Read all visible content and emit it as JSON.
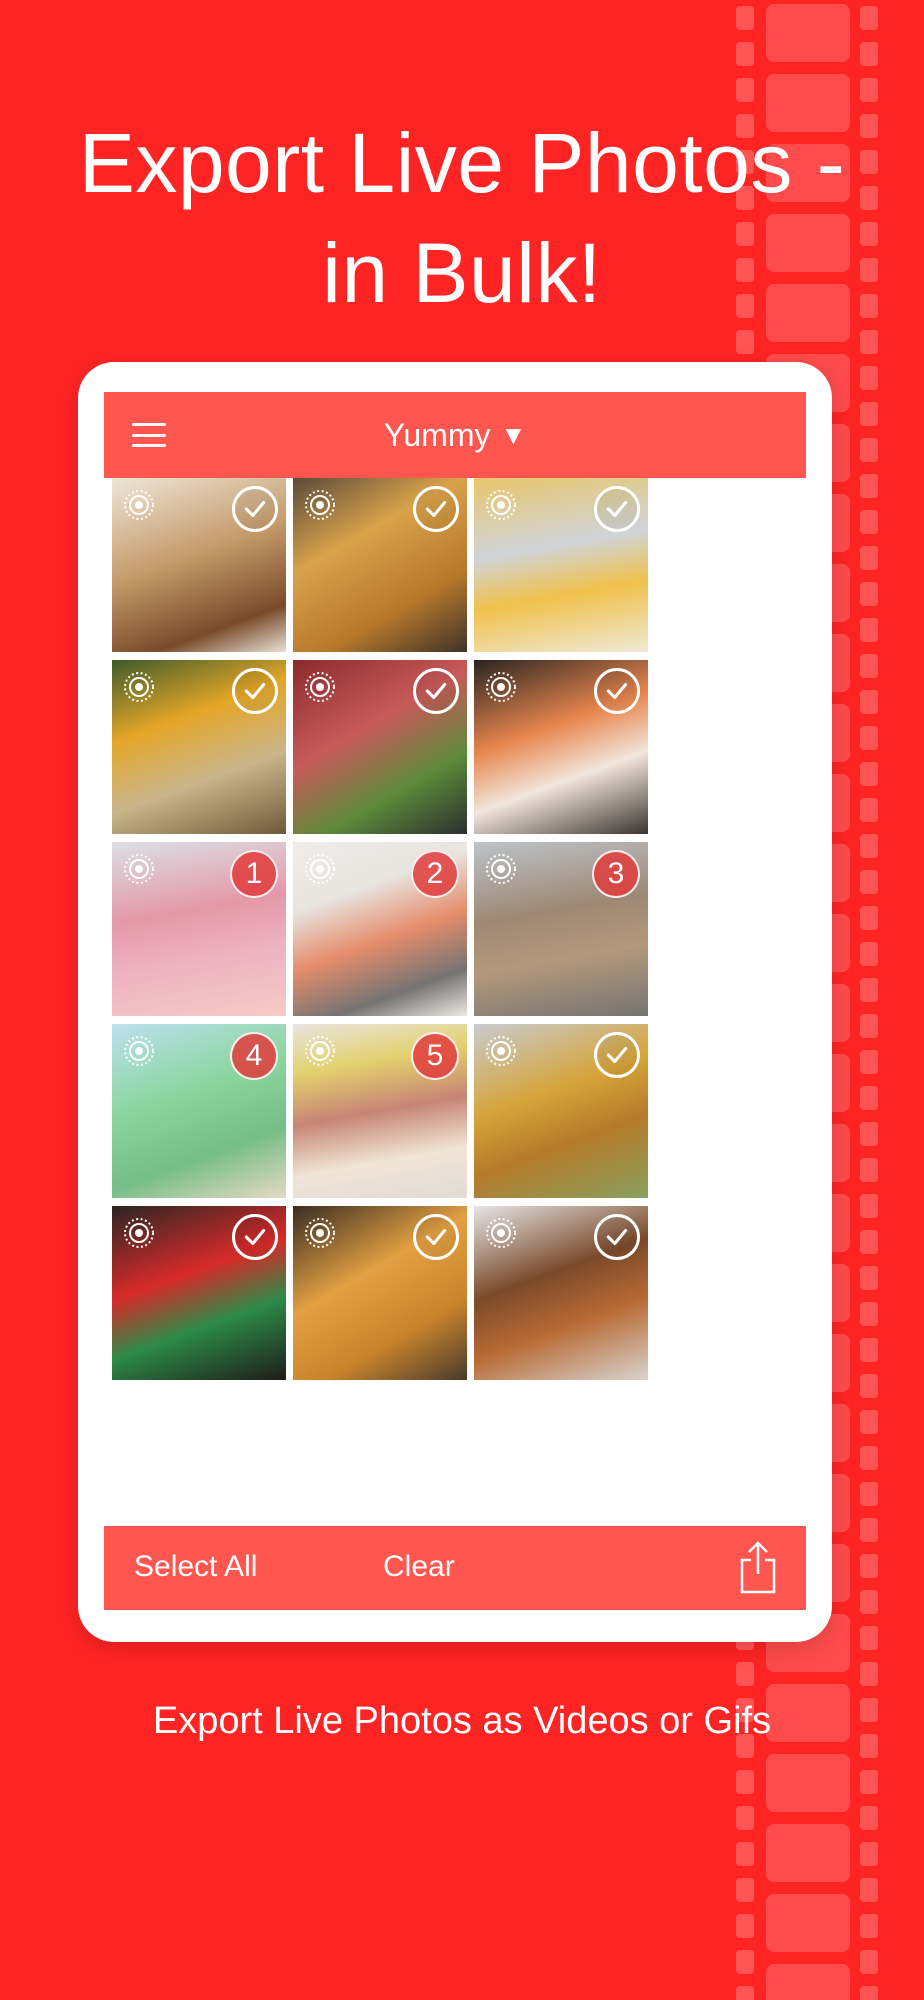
{
  "headline": {
    "line1": "Export Live Photos -",
    "line2": "in Bulk!"
  },
  "subtitle": "Export Live Photos as Videos or Gifs",
  "app": {
    "album_title": "Yummy",
    "album_caret": "▼",
    "bottom_bar": {
      "select_all_label": "Select All",
      "clear_label": "Clear"
    },
    "grid": [
      {
        "name": "dessert-photo",
        "state": "check",
        "badge": ""
      },
      {
        "name": "waffle-fries-photo",
        "state": "check",
        "badge": ""
      },
      {
        "name": "beer-fries-photo",
        "state": "check",
        "badge": ""
      },
      {
        "name": "curry-photo",
        "state": "check",
        "badge": ""
      },
      {
        "name": "steak-salad-photo",
        "state": "check",
        "badge": ""
      },
      {
        "name": "sushi-plate-photo",
        "state": "check",
        "badge": ""
      },
      {
        "name": "sashimi-bowl-photo",
        "state": "selected",
        "badge": "1"
      },
      {
        "name": "ikura-sushi-photo",
        "state": "selected",
        "badge": "2"
      },
      {
        "name": "hamburg-steak-photo",
        "state": "selected",
        "badge": "3"
      },
      {
        "name": "cream-soda-photo",
        "state": "selected",
        "badge": "4"
      },
      {
        "name": "hotdog-photo",
        "state": "selected",
        "badge": "5"
      },
      {
        "name": "draft-beer-photo",
        "state": "check",
        "badge": ""
      },
      {
        "name": "bottle-beer-photo",
        "state": "check",
        "badge": ""
      },
      {
        "name": "potato-fries-photo",
        "state": "check",
        "badge": ""
      },
      {
        "name": "fried-dish-photo",
        "state": "check",
        "badge": ""
      }
    ]
  },
  "colors": {
    "background": "#ff2424",
    "app_bar": "#ff574f",
    "badge": "#e03c3c"
  },
  "icons": {
    "menu": "hamburger-icon",
    "live_photo": "live-photo-icon",
    "check": "checkmark-icon",
    "share": "share-icon"
  }
}
